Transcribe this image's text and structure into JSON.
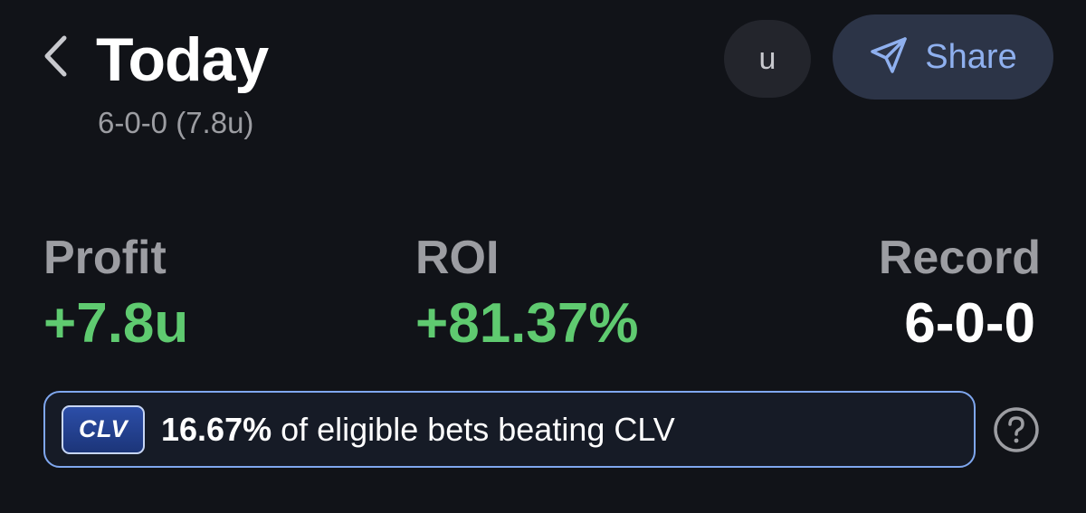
{
  "header": {
    "title": "Today",
    "subtitle": "6-0-0 (7.8u)",
    "unit_button_label": "u",
    "share_label": "Share",
    "back_icon": "chevron-left-icon",
    "share_icon": "send-icon"
  },
  "stats": [
    {
      "label": "Profit",
      "value": "+7.8u"
    },
    {
      "label": "ROI",
      "value": "+81.37%"
    },
    {
      "label": "Record",
      "value": "6-0-0"
    }
  ],
  "clv": {
    "badge": "CLV",
    "percent": "16.67%",
    "text": "of eligible bets beating CLV",
    "help_icon": "question-circle-icon"
  },
  "colors": {
    "background": "#111318",
    "positive": "#5fca70",
    "accent": "#8fb0ef",
    "muted": "#9c9da2",
    "clv_border": "#7fa7ef"
  }
}
